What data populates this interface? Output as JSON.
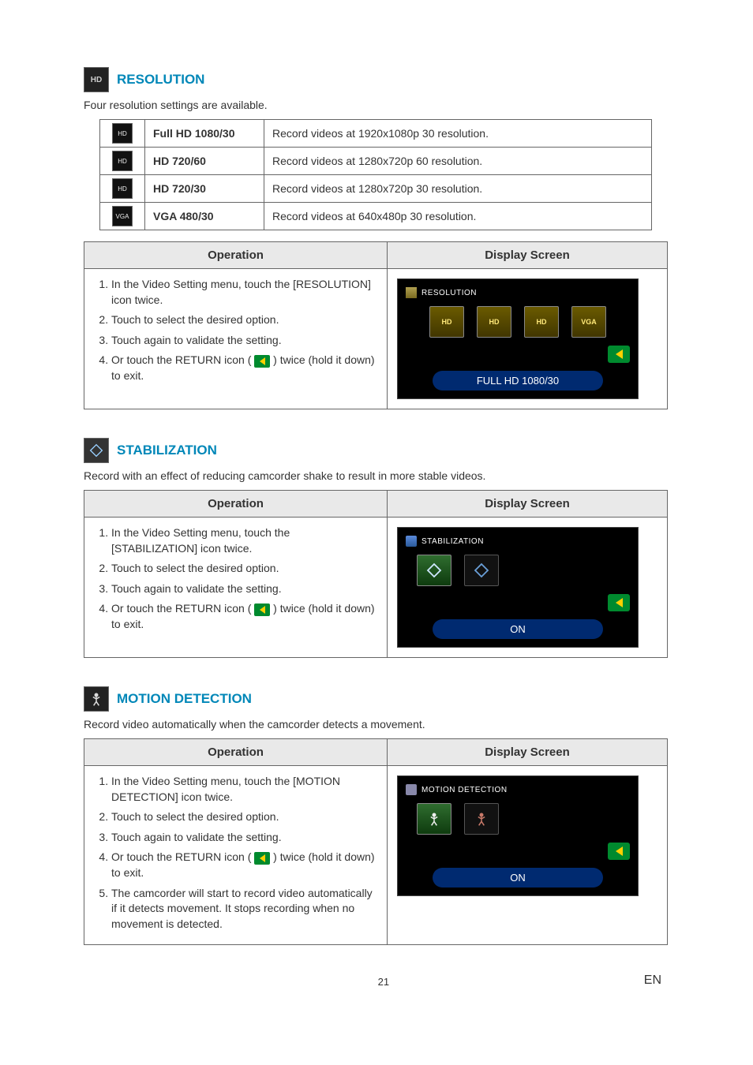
{
  "resolution": {
    "heading": "RESOLUTION",
    "intro": "Four resolution settings are available.",
    "rows": [
      {
        "icon": "HD",
        "label": "Full HD 1080/30",
        "desc": "Record videos at 1920x1080p 30 resolution."
      },
      {
        "icon": "HD",
        "label": "HD 720/60",
        "desc": "Record videos at 1280x720p 60 resolution."
      },
      {
        "icon": "HD",
        "label": "HD 720/30",
        "desc": "Record videos at 1280x720p 30 resolution."
      },
      {
        "icon": "VGA",
        "label": "VGA 480/30",
        "desc": "Record videos at 640x480p 30 resolution."
      }
    ],
    "op_header": "Operation",
    "ds_header": "Display Screen",
    "steps": {
      "s1": "In the Video Setting menu, touch the [RESOLUTION] icon twice.",
      "s2": "Touch to select the desired option.",
      "s3": "Touch again to validate the setting.",
      "s4a": "Or touch the RETURN icon (",
      "s4b": ") twice (hold it down) to exit."
    },
    "screen_header": "RESOLUTION",
    "screen_opts": [
      "HD",
      "HD",
      "HD",
      "VGA"
    ],
    "screen_status": "FULL HD 1080/30"
  },
  "stabilization": {
    "heading": "STABILIZATION",
    "intro": "Record with an effect of reducing camcorder shake to result in more stable videos.",
    "op_header": "Operation",
    "ds_header": "Display Screen",
    "steps": {
      "s1": "In the Video Setting menu, touch the [STABILIZATION] icon twice.",
      "s2": "Touch to select the desired option.",
      "s3": "Touch again to validate the setting.",
      "s4a": "Or touch the RETURN icon (",
      "s4b": ") twice (hold it down) to exit."
    },
    "screen_header": "STABILIZATION",
    "screen_status": "ON"
  },
  "motion": {
    "heading": "MOTION DETECTION",
    "intro": "Record video automatically when the camcorder detects a movement.",
    "op_header": "Operation",
    "ds_header": "Display Screen",
    "steps": {
      "s1": "In the Video Setting menu, touch the [MOTION DETECTION] icon twice.",
      "s2": "Touch to select the desired option.",
      "s3": "Touch again to validate the setting.",
      "s4a": "Or touch the RETURN icon (",
      "s4b": ") twice (hold it down) to exit.",
      "s5": "The camcorder will start to record video automatically if it detects movement. It stops recording when no movement is detected."
    },
    "screen_header": "MOTION DETECTION",
    "screen_status": "ON"
  },
  "footer": {
    "page": "21",
    "lang": "EN"
  }
}
